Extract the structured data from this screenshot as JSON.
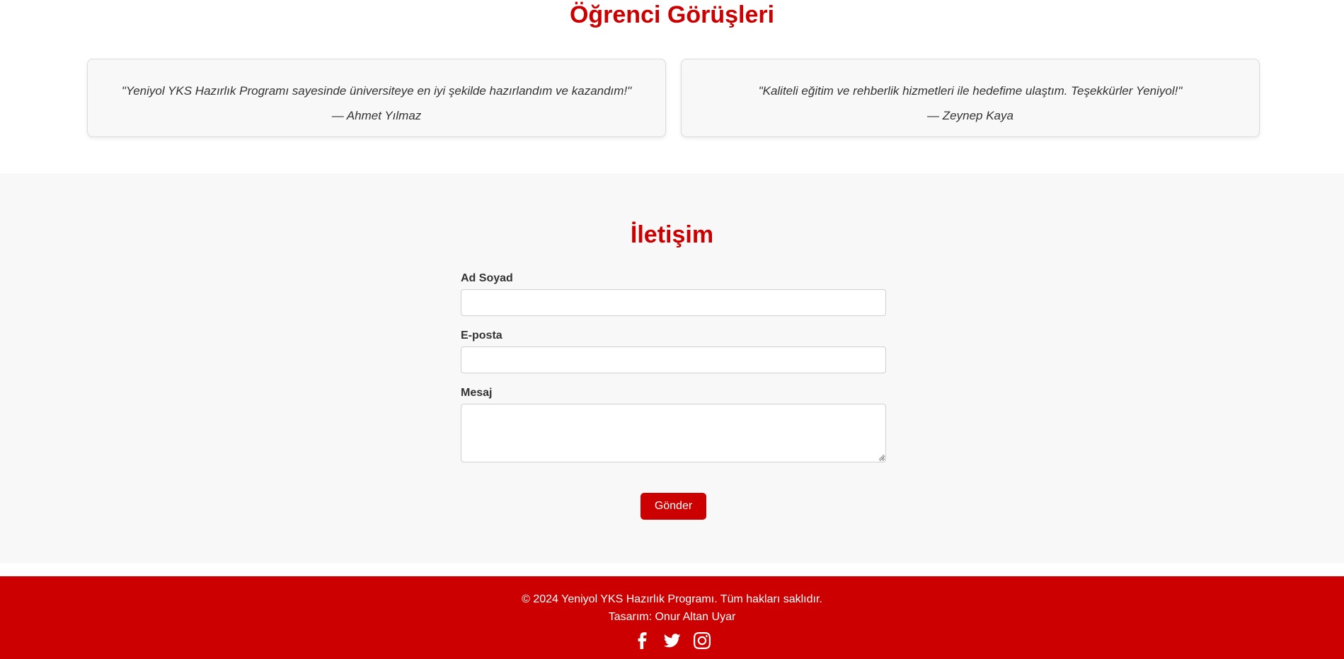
{
  "testimonials": {
    "title": "Öğrenci Görüşleri",
    "items": [
      {
        "quote": "\"Yeniyol YKS Hazırlık Programı sayesinde üniversiteye en iyi şekilde hazırlandım ve kazandım!\"",
        "author": "— Ahmet Yılmaz"
      },
      {
        "quote": "\"Kaliteli eğitim ve rehberlik hizmetleri ile hedefime ulaştım. Teşekkürler Yeniyol!\"",
        "author": "— Zeynep Kaya"
      }
    ]
  },
  "contact": {
    "title": "İletişim",
    "name_label": "Ad Soyad",
    "name_value": "",
    "email_label": "E-posta",
    "email_value": "",
    "message_label": "Mesaj",
    "message_value": "",
    "submit_label": "Gönder"
  },
  "footer": {
    "copyright": "© 2024 Yeniyol YKS Hazırlık Programı. Tüm hakları saklıdır.",
    "designer": "Tasarım: Onur Altan Uyar",
    "social_icons": [
      "facebook-icon",
      "twitter-icon",
      "instagram-icon"
    ]
  },
  "colors": {
    "accent": "#cc0000",
    "section_bg": "#f8f8f8",
    "text": "#333333"
  }
}
